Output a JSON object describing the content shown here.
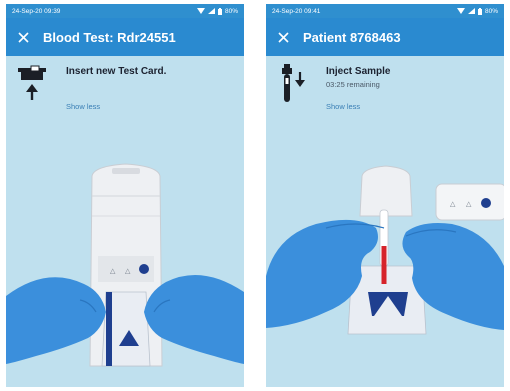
{
  "left_screen": {
    "status": {
      "time": "24-Sep-20 09:39",
      "battery": "80%"
    },
    "appbar": {
      "title": "Blood Test: Rdr24551"
    },
    "instruction": {
      "icon": "insert-card-icon",
      "title": "Insert new Test Card.",
      "show_less": "Show less"
    }
  },
  "right_screen": {
    "status": {
      "time": "24-Sep-20 09:41",
      "battery": "80%"
    },
    "appbar": {
      "title": "Patient 8768463"
    },
    "instruction": {
      "icon": "inject-sample-icon",
      "title": "Inject Sample",
      "subtitle": "03:25 remaining",
      "show_less": "Show less"
    }
  },
  "colors": {
    "status_bar": "#2f8fcf",
    "app_bar": "#2a8ad0",
    "background": "#bfe0ee",
    "glove": "#3b8fdc",
    "device": "#eef0f3",
    "card_accent": "#1f3f8f",
    "sample_red": "#d6232a"
  }
}
